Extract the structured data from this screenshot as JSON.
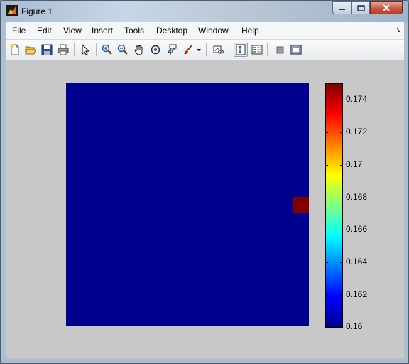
{
  "window": {
    "title": "Figure 1"
  },
  "menu": {
    "items": [
      "File",
      "Edit",
      "View",
      "Insert",
      "Tools",
      "Desktop",
      "Window",
      "Help"
    ]
  },
  "toolbar": {
    "buttons": [
      {
        "name": "new-figure",
        "icon": "new-document-icon"
      },
      {
        "name": "open-file",
        "icon": "folder-open-icon"
      },
      {
        "name": "save-figure",
        "icon": "save-icon"
      },
      {
        "name": "print-figure",
        "icon": "printer-icon"
      },
      {
        "name": "edit-plot",
        "icon": "pointer-arrow-icon"
      },
      {
        "name": "zoom-in",
        "icon": "zoom-in-icon"
      },
      {
        "name": "zoom-out",
        "icon": "zoom-out-icon"
      },
      {
        "name": "pan",
        "icon": "hand-icon"
      },
      {
        "name": "rotate-3d",
        "icon": "rotate-3d-icon"
      },
      {
        "name": "data-cursor",
        "icon": "data-cursor-icon"
      },
      {
        "name": "brush",
        "icon": "brush-icon"
      },
      {
        "name": "link-plot",
        "icon": "link-plot-icon"
      },
      {
        "name": "insert-colorbar",
        "icon": "colorbar-icon",
        "pressed": true
      },
      {
        "name": "insert-legend",
        "icon": "legend-icon"
      },
      {
        "name": "hide-plot-tools",
        "icon": "hide-plot-tools-icon"
      },
      {
        "name": "show-plot-tools",
        "icon": "show-plot-tools-icon"
      }
    ]
  },
  "figure": {
    "background": "#c8c8c8",
    "image_fill_color": "#00008f",
    "hot_cell_color": "#800000"
  },
  "chart_data": {
    "type": "heatmap",
    "colormap": "jet",
    "colorbar": {
      "clim": [
        0.16,
        0.175
      ],
      "tick_labels": [
        "0.174",
        "0.172",
        "0.17",
        "0.168",
        "0.166",
        "0.164",
        "0.162",
        "0.16"
      ],
      "tick_values": [
        0.174,
        0.172,
        0.17,
        0.168,
        0.166,
        0.164,
        0.162,
        0.16
      ]
    },
    "grid": "uniform field at minimum value with a single cell at maximum value on the right edge"
  }
}
